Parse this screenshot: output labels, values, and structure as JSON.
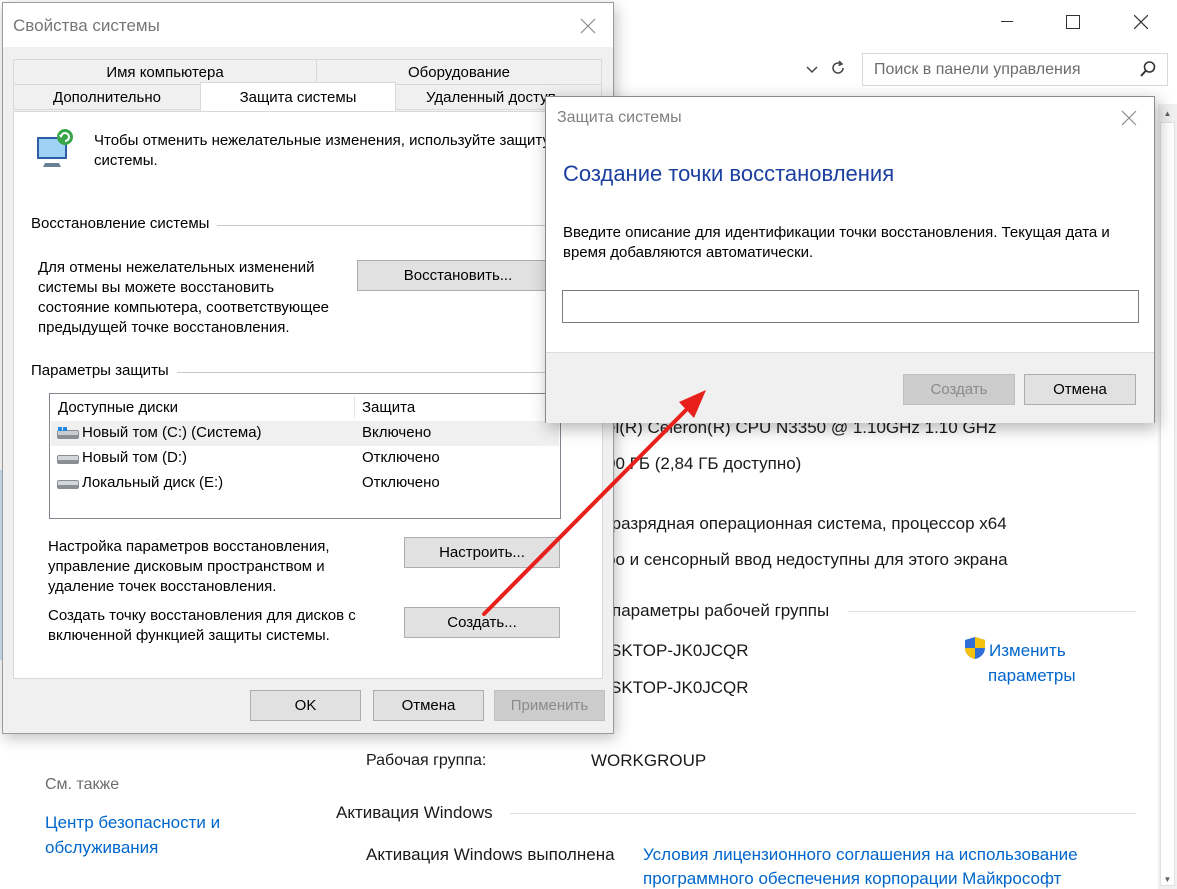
{
  "background": {
    "search_placeholder": "Поиск в панели управления",
    "processor_partial": "el(R) Celeron(R) CPU N3350 @ 1.10GHz   1.10 GHz",
    "ram_partial": "00 ГБ (2,84 ГБ доступно)",
    "system_type_partial": "-разрядная операционная система, процессор x64",
    "pen_touch_partial": "ро и сенсорный ввод недоступны для этого экрана",
    "workgroup_params_partial": "параметры рабочей группы",
    "computer_name_partial": "SKTOP-JK0JCQR",
    "full_name_partial": "SKTOP-JK0JCQR",
    "change_settings_line1": "Изменить",
    "change_settings_line2": "параметры",
    "workgroup_label": "Рабочая группа:",
    "workgroup_value": "WORKGROUP",
    "see_also": "См. также",
    "security_link_line1": "Центр безопасности и",
    "security_link_line2": "обслуживания",
    "activation_header": "Активация Windows",
    "activation_status": "Активация Windows выполнена",
    "license_link_line1": "Условия лицензионного соглашения на использование",
    "license_link_line2": "программного обеспечения корпорации Майкрософт"
  },
  "system_properties": {
    "title": "Свойства системы",
    "tabs_row1": [
      "Имя компьютера",
      "Оборудование"
    ],
    "tabs_row2": [
      "Дополнительно",
      "Защита системы",
      "Удаленный доступ"
    ],
    "active_tab": "Защита системы",
    "intro_text": "Чтобы отменить нежелательные изменения, используйте защиту системы.",
    "restore_group": "Восстановление системы",
    "restore_desc": "Для отмены нежелательных изменений системы вы можете восстановить состояние компьютера, соответствующее предыдущей точке восстановления.",
    "restore_button": "Восстановить...",
    "protection_group": "Параметры защиты",
    "drives_header": "Доступные диски",
    "protection_header": "Защита",
    "drives": [
      {
        "name": "Новый том (C:) (Система)",
        "status": "Включено",
        "icon": "system-drive-icon"
      },
      {
        "name": "Новый том (D:)",
        "status": "Отключено",
        "icon": "drive-icon"
      },
      {
        "name": "Локальный диск (E:)",
        "status": "Отключено",
        "icon": "drive-icon"
      }
    ],
    "configure_desc": "Настройка параметров восстановления, управление дисковым пространством и удаление точек восстановления.",
    "configure_button": "Настроить...",
    "create_desc": "Создать точку восстановления для дисков с включенной функцией защиты системы.",
    "create_button": "Создать...",
    "ok_button": "OK",
    "cancel_button": "Отмена",
    "apply_button": "Применить"
  },
  "protection_dialog": {
    "title": "Защита системы",
    "heading": "Создание точки восстановления",
    "description": "Введите описание для идентификации точки восстановления. Текущая дата и время добавляются автоматически.",
    "input_value": "",
    "create_button": "Создать",
    "cancel_button": "Отмена"
  },
  "colors": {
    "heading_blue": "#1a3fa0",
    "link_blue": "#0066cc",
    "arrow_red": "#e8201c",
    "dialog_grey": "#f0f0f0"
  }
}
